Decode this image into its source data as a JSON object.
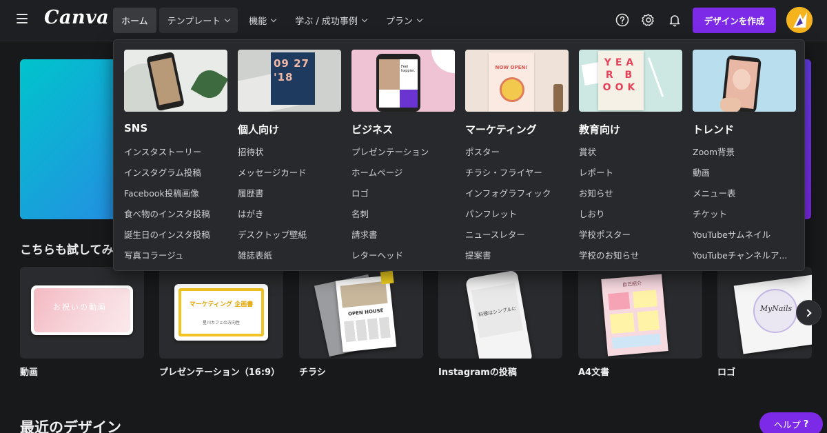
{
  "header": {
    "logo": "Canva",
    "nav": [
      {
        "label": "ホーム",
        "has_chevron": false
      },
      {
        "label": "テンプレート",
        "has_chevron": true
      },
      {
        "label": "機能",
        "has_chevron": true
      },
      {
        "label": "学ぶ / 成功事例",
        "has_chevron": true
      },
      {
        "label": "プラン",
        "has_chevron": true
      }
    ],
    "icons": [
      "help-circle-icon",
      "gear-icon",
      "bell-icon"
    ],
    "create_button": "デザインを作成"
  },
  "templates_menu": {
    "columns": [
      {
        "title": "SNS",
        "thumb_text": "",
        "items": [
          "インスタストーリー",
          "インスタグラム投稿",
          "Facebook投稿画像",
          "食べ物のインスタ投稿",
          "誕生日のインスタ投稿",
          "写真コラージュ"
        ]
      },
      {
        "title": "個人向け",
        "thumb_text": "09 27 '18",
        "items": [
          "招待状",
          "メッセージカード",
          "履歴書",
          "はがき",
          "デスクトップ壁紙",
          "雑誌表紙"
        ]
      },
      {
        "title": "ビジネス",
        "thumb_text": "Feel happier.",
        "items": [
          "プレゼンテーション",
          "ホームページ",
          "ロゴ",
          "名刺",
          "請求書",
          "レターヘッド"
        ]
      },
      {
        "title": "マーケティング",
        "thumb_text": "NOW OPEN!",
        "items": [
          "ポスター",
          "チラシ・フライヤー",
          "インフォグラフィック",
          "パンフレット",
          "ニュースレター",
          "提案書"
        ]
      },
      {
        "title": "教育向け",
        "thumb_text": "YEAR BOOK",
        "items": [
          "賞状",
          "レポート",
          "お知らせ",
          "しおり",
          "学校ポスター",
          "学校のお知らせ"
        ]
      },
      {
        "title": "トレンド",
        "thumb_text": "",
        "items": [
          "Zoom背景",
          "動画",
          "メニュー表",
          "チケット",
          "YouTubeサムネイル",
          "YouTubeチャンネルア..."
        ]
      }
    ]
  },
  "try_section": {
    "title": "こちらも試してみ",
    "cards": [
      {
        "label": "動画",
        "thumb_text": "お祝いの動画"
      },
      {
        "label": "プレゼンテーション（16:9）",
        "thumb_text": "マーケティング 企画書",
        "thumb_sub": "星川カフェの方向性"
      },
      {
        "label": "チラシ",
        "thumb_text": "OPEN HOUSE"
      },
      {
        "label": "Instagramの投稿",
        "thumb_text": "料理はシンプルに"
      },
      {
        "label": "A4文書",
        "thumb_text": "自己紹介"
      },
      {
        "label": "ロゴ",
        "thumb_text": "MyNails"
      }
    ]
  },
  "recent": {
    "title": "最近のデザイン"
  },
  "help": {
    "label": "ヘルプ",
    "symbol": "?"
  },
  "colors": {
    "accent": "#7d2ae8",
    "background": "#18191b",
    "topbar": "#1e1f22",
    "menu": "#28292c"
  }
}
